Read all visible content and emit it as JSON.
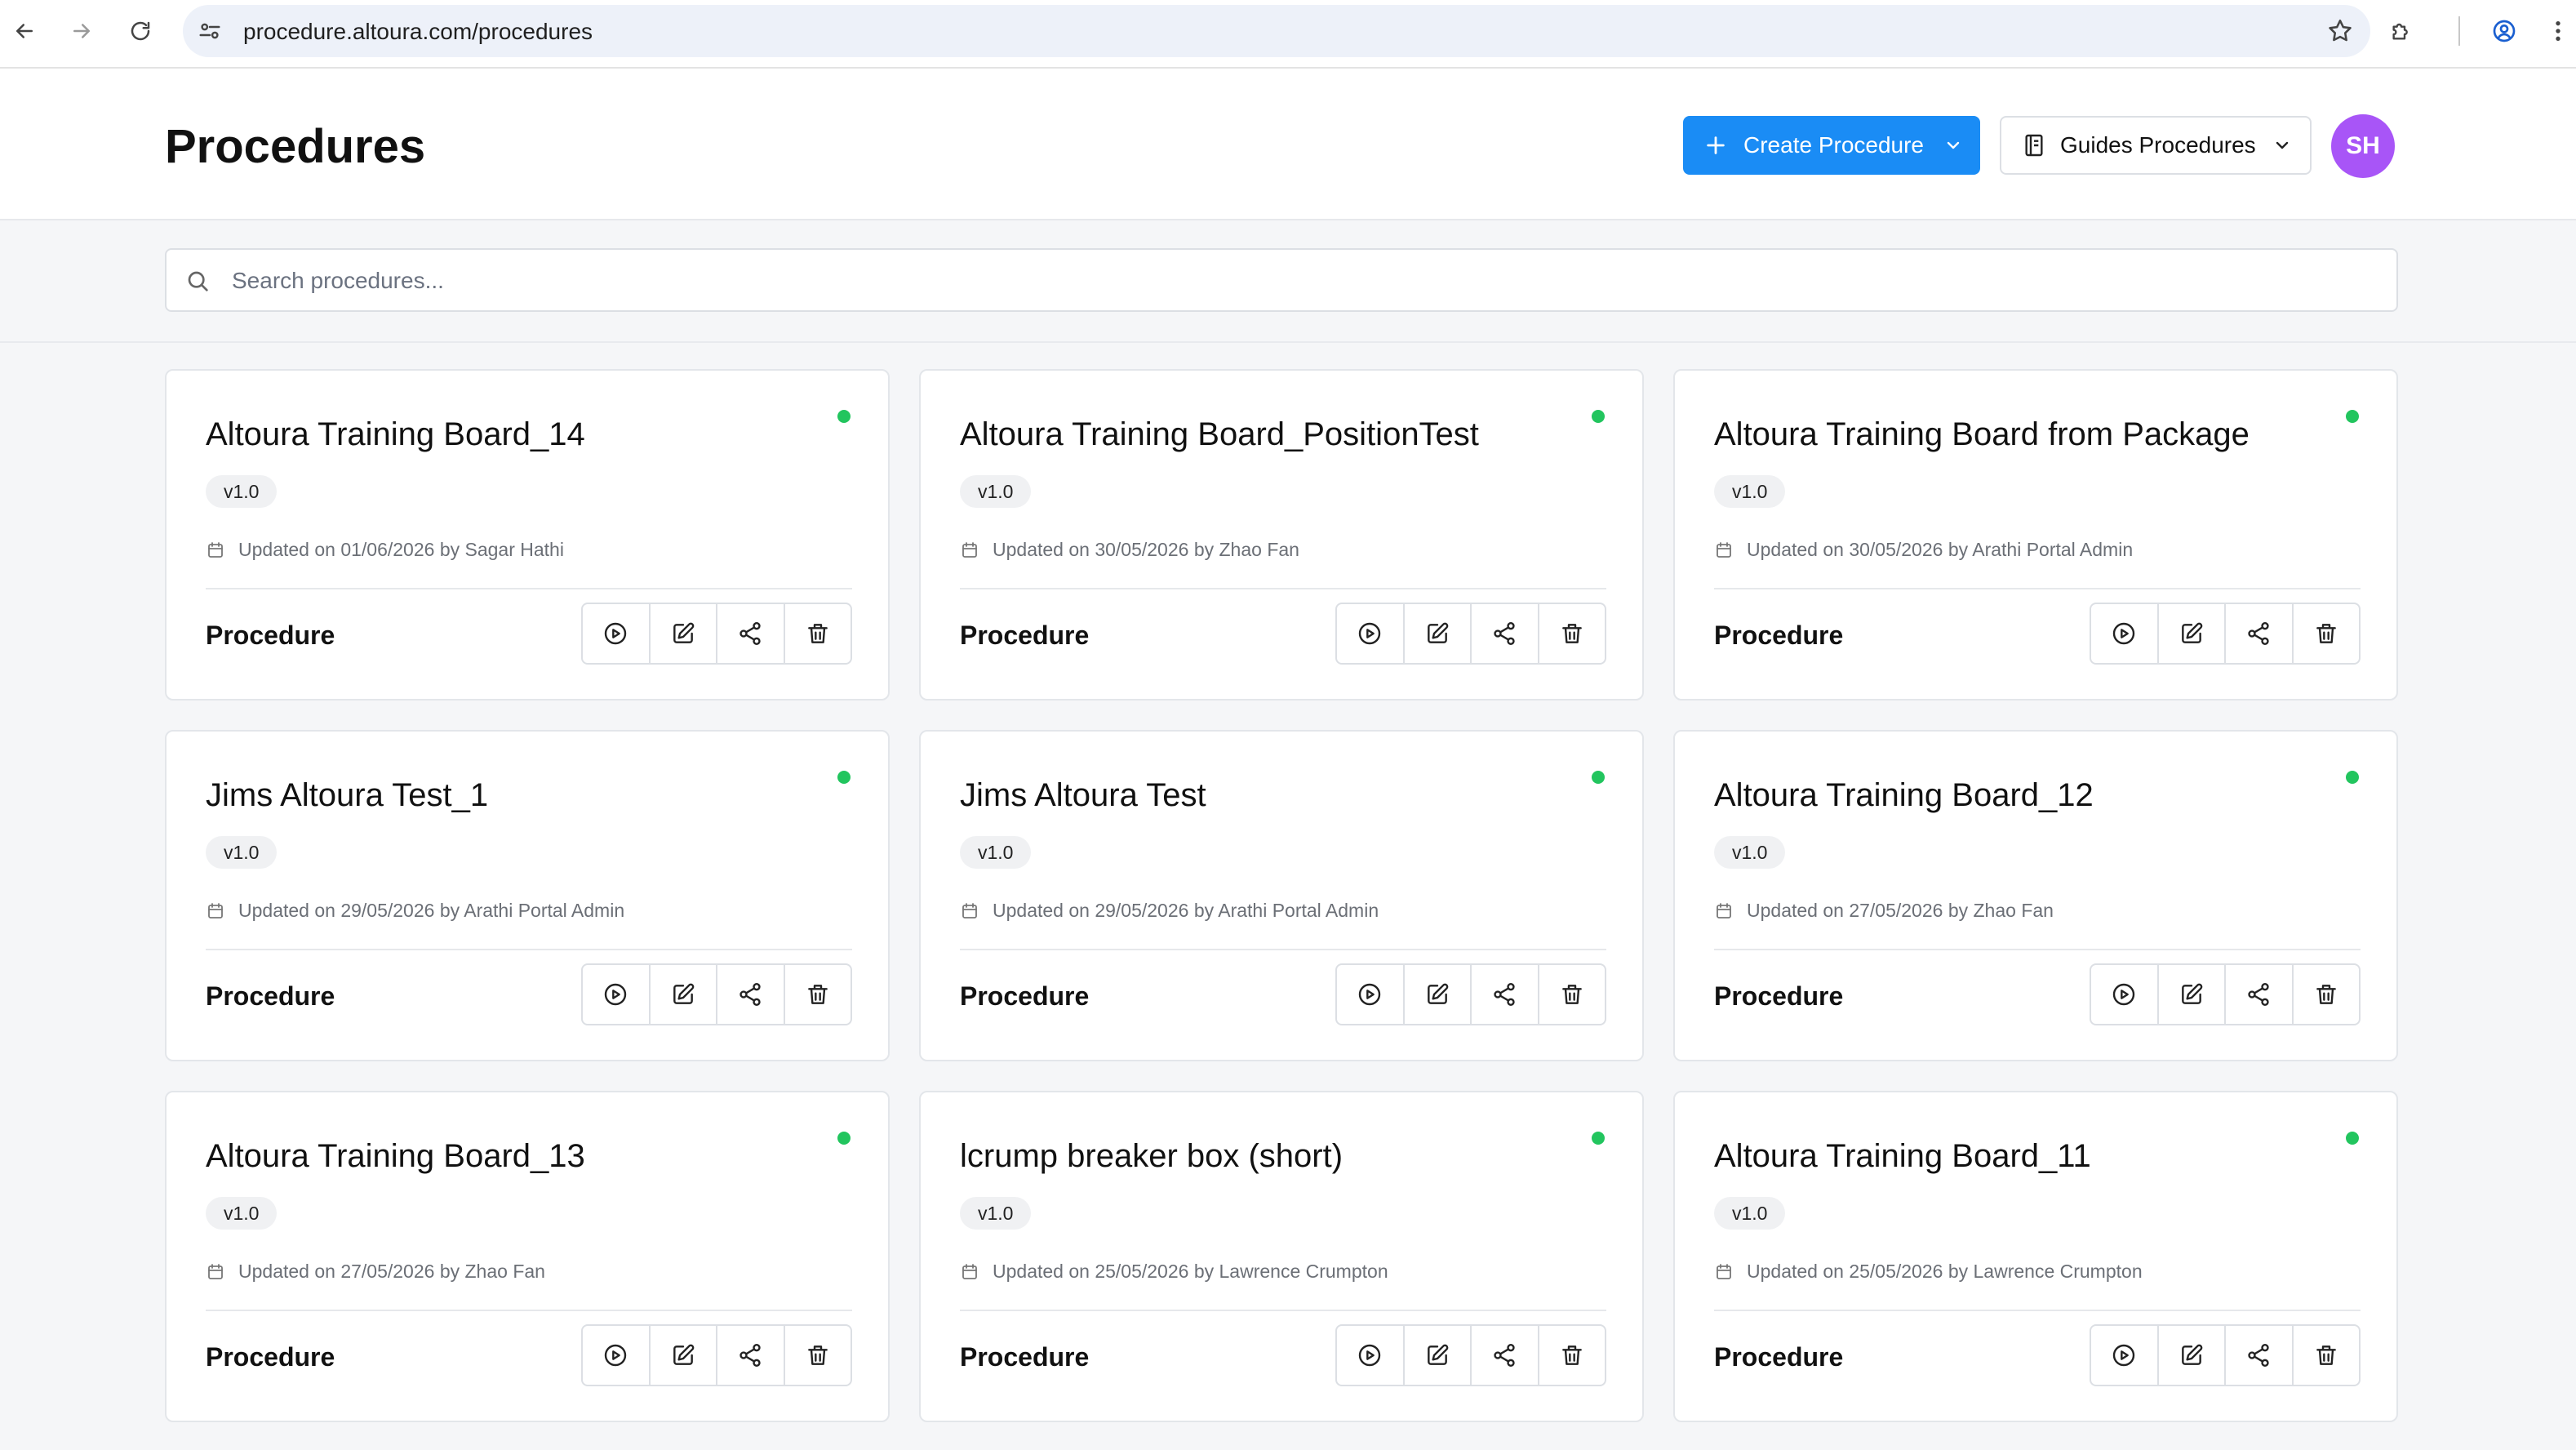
{
  "browser": {
    "url": "procedure.altoura.com/procedures"
  },
  "header": {
    "title": "Procedures",
    "create_label": "Create Procedure",
    "guides_label": "Guides Procedures",
    "avatar_initials": "SH",
    "avatar_color": "#a855f7",
    "accent_color": "#1a8cf5"
  },
  "search": {
    "placeholder": "Search procedures..."
  },
  "cards": [
    {
      "title": "Altoura Training Board_14",
      "version": "v1.0",
      "updated": "Updated on 01/06/2026 by Sagar Hathi",
      "type": "Procedure",
      "status_color": "#22c55e"
    },
    {
      "title": "Altoura Training Board_PositionTest",
      "version": "v1.0",
      "updated": "Updated on 30/05/2026 by Zhao Fan",
      "type": "Procedure",
      "status_color": "#22c55e"
    },
    {
      "title": "Altoura Training Board from Package",
      "version": "v1.0",
      "updated": "Updated on 30/05/2026 by Arathi Portal Admin",
      "type": "Procedure",
      "status_color": "#22c55e"
    },
    {
      "title": "Jims Altoura Test_1",
      "version": "v1.0",
      "updated": "Updated on 29/05/2026 by Arathi Portal Admin",
      "type": "Procedure",
      "status_color": "#22c55e"
    },
    {
      "title": "Jims Altoura Test",
      "version": "v1.0",
      "updated": "Updated on 29/05/2026 by Arathi Portal Admin",
      "type": "Procedure",
      "status_color": "#22c55e"
    },
    {
      "title": "Altoura Training Board_12",
      "version": "v1.0",
      "updated": "Updated on 27/05/2026 by Zhao Fan",
      "type": "Procedure",
      "status_color": "#22c55e"
    },
    {
      "title": "Altoura Training Board_13",
      "version": "v1.0",
      "updated": "Updated on 27/05/2026 by Zhao Fan",
      "type": "Procedure",
      "status_color": "#22c55e"
    },
    {
      "title": "lcrump breaker box (short)",
      "version": "v1.0",
      "updated": "Updated on 25/05/2026 by Lawrence Crumpton",
      "type": "Procedure",
      "status_color": "#22c55e"
    },
    {
      "title": "Altoura Training Board_11",
      "version": "v1.0",
      "updated": "Updated on 25/05/2026 by Lawrence Crumpton",
      "type": "Procedure",
      "status_color": "#22c55e"
    }
  ],
  "card_actions": [
    "play-icon",
    "edit-icon",
    "share-icon",
    "trash-icon"
  ]
}
